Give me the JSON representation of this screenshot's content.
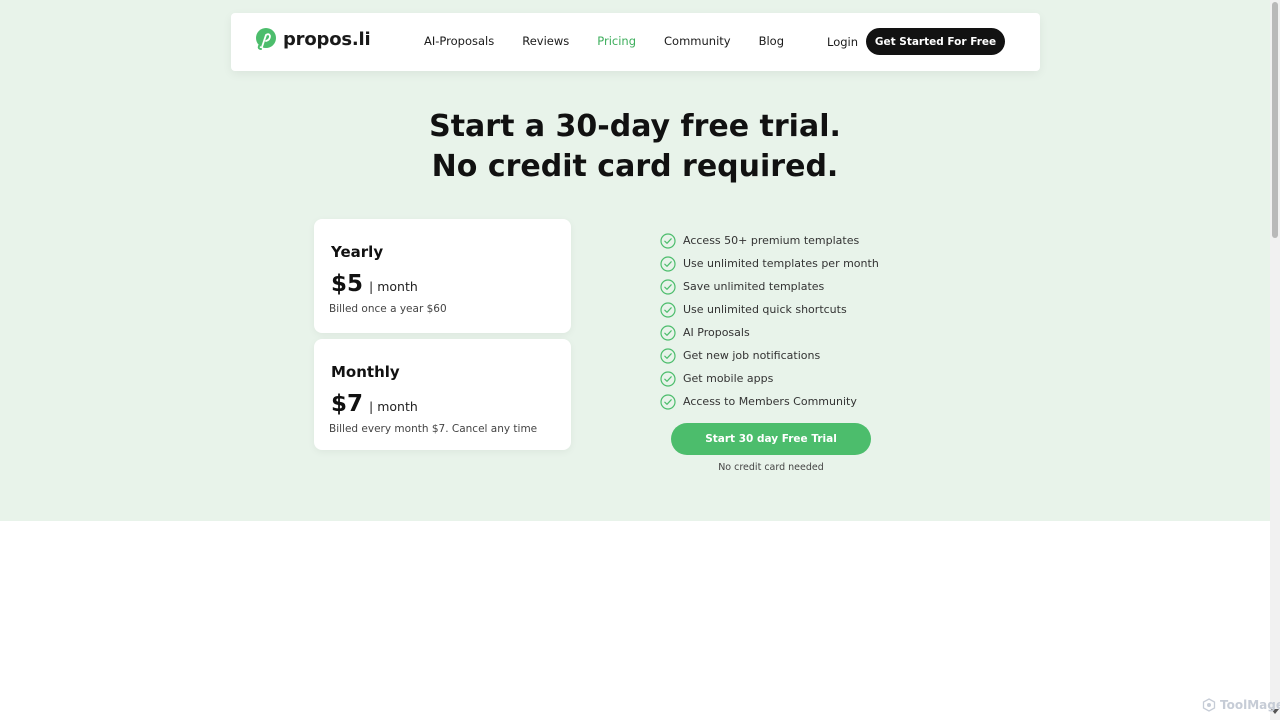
{
  "brand": {
    "name": "propos.li",
    "accent": "#3dae5c",
    "button_green": "#4cbd6c",
    "dark": "#121212"
  },
  "nav": {
    "links": [
      {
        "label": "AI-Proposals"
      },
      {
        "label": "Reviews"
      },
      {
        "label": "Pricing",
        "active": true
      },
      {
        "label": "Community"
      },
      {
        "label": "Blog"
      }
    ],
    "login_label": "Login",
    "cta_label": "Get Started For Free"
  },
  "hero": {
    "headline_line1": "Start a 30-day free trial.",
    "headline_line2": "No credit card required."
  },
  "plans": [
    {
      "name": "Yearly",
      "price": "$5",
      "period": "| month",
      "note": "Billed once a year $60"
    },
    {
      "name": "Monthly",
      "price": "$7",
      "period": "| month",
      "note": "Billed every month $7. Cancel any time"
    }
  ],
  "features": [
    "Access 50+ premium templates",
    "Use unlimited templates per month",
    "Save unlimited templates",
    "Use unlimited quick shortcuts",
    "AI Proposals",
    "Get new job notifications",
    "Get mobile apps",
    "Access to Members Community"
  ],
  "cta": {
    "label": "Start 30 day Free Trial",
    "subtext": "No credit card needed"
  },
  "watermark": {
    "text": "ToolMage"
  }
}
